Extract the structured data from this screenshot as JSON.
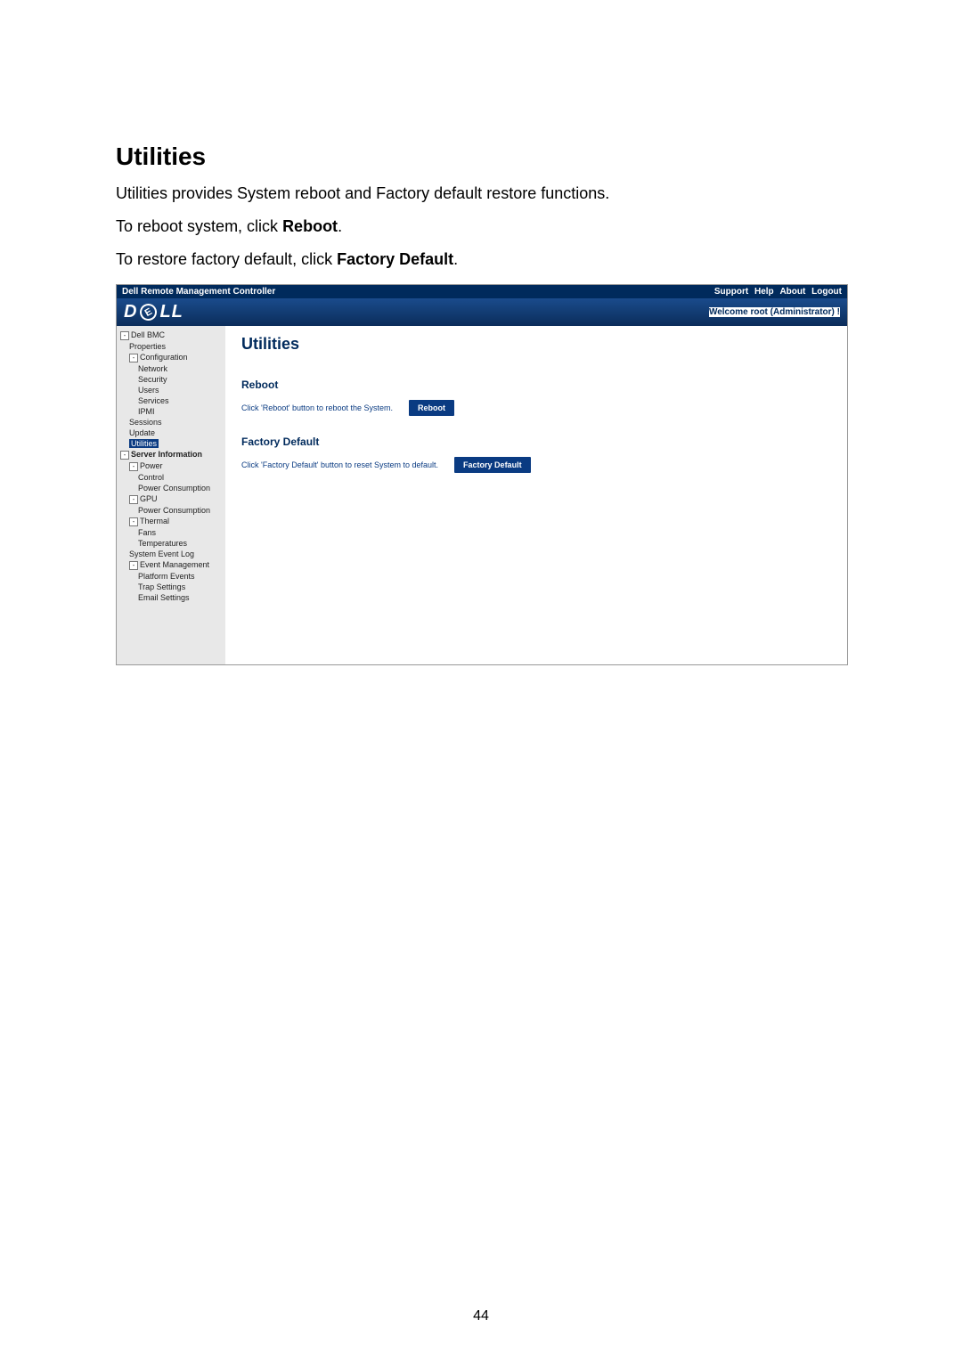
{
  "doc": {
    "heading": "Utilities",
    "para1_a": "Utilities provides System reboot and Factory default restore functions.",
    "para2_a": "To reboot system, click ",
    "para2_b": "Reboot",
    "para2_c": ".",
    "para3_a": "To restore factory default, click ",
    "para3_b": "Factory Default",
    "para3_c": ".",
    "page_number": "44"
  },
  "shot": {
    "topbar_title": "Dell Remote Management Controller",
    "links": {
      "support": "Support",
      "help": "Help",
      "about": "About",
      "logout": "Logout"
    },
    "brand_a": "D",
    "brand_b": "LL",
    "welcome": "Welcome root (Administrator) !",
    "nav": {
      "dell_bmc": "Dell BMC",
      "properties": "Properties",
      "configuration": "Configuration",
      "network": "Network",
      "security": "Security",
      "users": "Users",
      "services": "Services",
      "ipmi": "IPMI",
      "sessions": "Sessions",
      "update": "Update",
      "utilities": "Utilities",
      "server_info": "Server Information",
      "power": "Power",
      "control": "Control",
      "power_cons1": "Power Consumption",
      "gpu": "GPU",
      "power_cons2": "Power Consumption",
      "thermal": "Thermal",
      "fans": "Fans",
      "temperatures": "Temperatures",
      "sys_event_log": "System Event Log",
      "event_mgmt": "Event Management",
      "platform_events": "Platform Events",
      "trap_settings": "Trap Settings",
      "email_settings": "Email Settings"
    },
    "content": {
      "title": "Utilities",
      "reboot_h": "Reboot",
      "reboot_txt": "Click 'Reboot' button to reboot the System.",
      "reboot_btn": "Reboot",
      "fd_h": "Factory Default",
      "fd_txt": "Click 'Factory Default' button to reset System to default.",
      "fd_btn": "Factory Default"
    }
  }
}
